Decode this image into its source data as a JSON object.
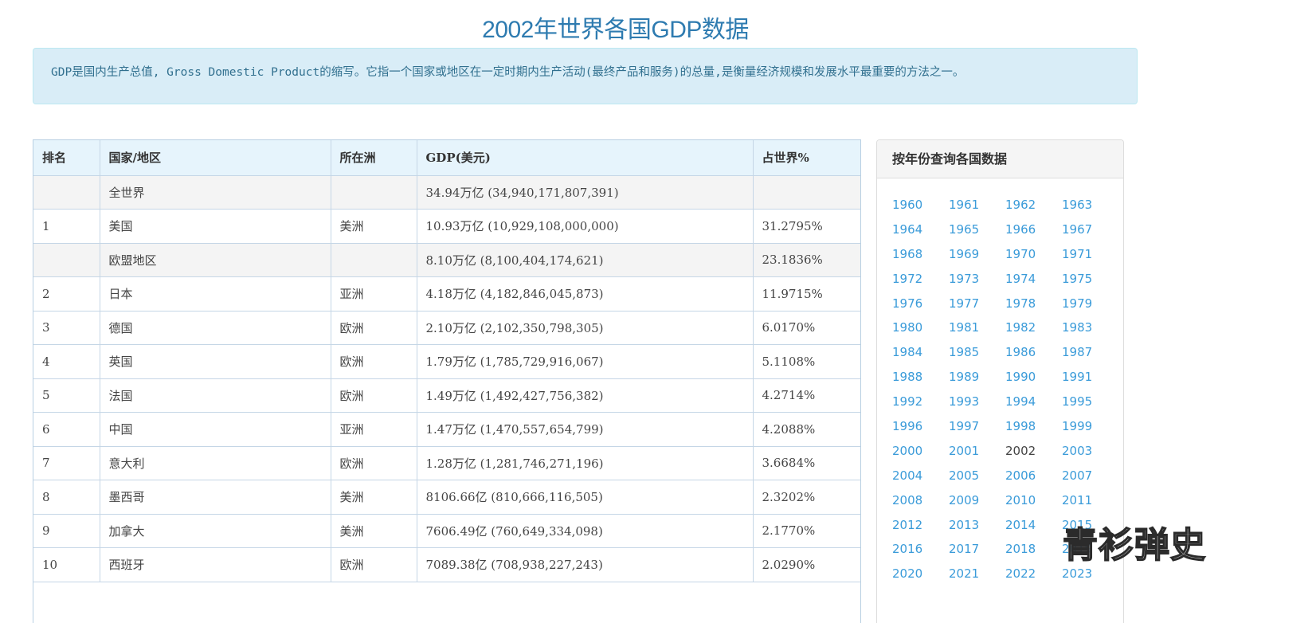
{
  "page": {
    "title": "2002年世界各国GDP数据",
    "intro": "GDP是国内生产总值, Gross Domestic Product的缩写。它指一个国家或地区在一定时期内生产活动(最终产品和服务)的总量,是衡量经济规模和发展水平最重要的方法之一。"
  },
  "table": {
    "headers": [
      "排名",
      "国家/地区",
      "所在洲",
      "GDP(美元)",
      "占世界%"
    ],
    "rows": [
      {
        "rank": "",
        "country": "全世界",
        "continent": "",
        "gdp": "34.94万亿 (34,940,171,807,391)",
        "share": "",
        "shaded": true
      },
      {
        "rank": "1",
        "country": "美国",
        "continent": "美洲",
        "gdp": "10.93万亿 (10,929,108,000,000)",
        "share": "31.2795%",
        "shaded": false
      },
      {
        "rank": "",
        "country": "欧盟地区",
        "continent": "",
        "gdp": "8.10万亿 (8,100,404,174,621)",
        "share": "23.1836%",
        "shaded": true
      },
      {
        "rank": "2",
        "country": "日本",
        "continent": "亚洲",
        "gdp": "4.18万亿 (4,182,846,045,873)",
        "share": "11.9715%",
        "shaded": false
      },
      {
        "rank": "3",
        "country": "德国",
        "continent": "欧洲",
        "gdp": "2.10万亿 (2,102,350,798,305)",
        "share": "6.0170%",
        "shaded": false
      },
      {
        "rank": "4",
        "country": "英国",
        "continent": "欧洲",
        "gdp": "1.79万亿 (1,785,729,916,067)",
        "share": "5.1108%",
        "shaded": false
      },
      {
        "rank": "5",
        "country": "法国",
        "continent": "欧洲",
        "gdp": "1.49万亿 (1,492,427,756,382)",
        "share": "4.2714%",
        "shaded": false
      },
      {
        "rank": "6",
        "country": "中国",
        "continent": "亚洲",
        "gdp": "1.47万亿 (1,470,557,654,799)",
        "share": "4.2088%",
        "shaded": false
      },
      {
        "rank": "7",
        "country": "意大利",
        "continent": "欧洲",
        "gdp": "1.28万亿 (1,281,746,271,196)",
        "share": "3.6684%",
        "shaded": false
      },
      {
        "rank": "8",
        "country": "墨西哥",
        "continent": "美洲",
        "gdp": "8106.66亿 (810,666,116,505)",
        "share": "2.3202%",
        "shaded": false
      },
      {
        "rank": "9",
        "country": "加拿大",
        "continent": "美洲",
        "gdp": "7606.49亿 (760,649,334,098)",
        "share": "2.1770%",
        "shaded": false
      },
      {
        "rank": "10",
        "country": "西班牙",
        "continent": "欧洲",
        "gdp": "7089.38亿 (708,938,227,243)",
        "share": "2.0290%",
        "shaded": false
      }
    ]
  },
  "sidebar": {
    "title": "按年份查询各国数据",
    "current_year": "2002",
    "years": [
      "1960",
      "1961",
      "1962",
      "1963",
      "1964",
      "1965",
      "1966",
      "1967",
      "1968",
      "1969",
      "1970",
      "1971",
      "1972",
      "1973",
      "1974",
      "1975",
      "1976",
      "1977",
      "1978",
      "1979",
      "1980",
      "1981",
      "1982",
      "1983",
      "1984",
      "1985",
      "1986",
      "1987",
      "1988",
      "1989",
      "1990",
      "1991",
      "1992",
      "1993",
      "1994",
      "1995",
      "1996",
      "1997",
      "1998",
      "1999",
      "2000",
      "2001",
      "2002",
      "2003",
      "2004",
      "2005",
      "2006",
      "2007",
      "2008",
      "2009",
      "2010",
      "2011",
      "2012",
      "2013",
      "2014",
      "2015",
      "2016",
      "2017",
      "2018",
      "2019",
      "2020",
      "2021",
      "2022",
      "2023"
    ]
  },
  "watermark": "青衫弹史",
  "colors": {
    "title": "#2e7bb0",
    "intro_bg": "#d9edf7",
    "intro_text": "#31708f",
    "header_bg": "#e6f4fc",
    "link": "#3a9bd9"
  }
}
